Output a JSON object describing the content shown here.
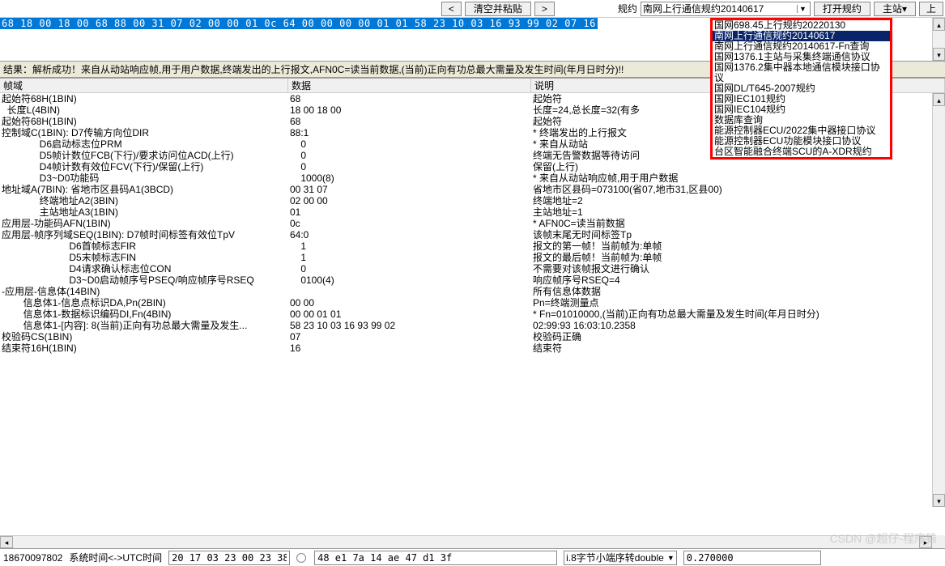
{
  "toolbar": {
    "prev_btn": "<",
    "clear_paste_btn": "清空并粘贴",
    "next_btn": ">",
    "protocol_label": "规约",
    "protocol_selected": "南网上行通信规约20140617",
    "open_protocol_btn": "打开规约",
    "master_btn": "主站",
    "more_btn": "上"
  },
  "hex_input": "68 18 00 18 00 68 88 00 31 07 02 00 00 01 0c 64 00 00 00 00 01 01 58 23 10 03 16 93 99 02 07 16",
  "result_bar": "结果：解析成功！来自从动站响应帧,用于用户数据,终端发出的上行报文,AFN0C=读当前数据,(当前)正向有功总最大需量及发生时间(年月日时分)!!",
  "headers": {
    "c1": "帧域",
    "c2": "数据",
    "c3": "说明"
  },
  "rows": [
    {
      "c1": "起始符68H(1BIN)",
      "c2": "68",
      "c3": "起始符"
    },
    {
      "c1": "  长度L(4BIN)",
      "c2": "18 00 18 00",
      "c3": "长度=24,总长度=32(有多"
    },
    {
      "c1": "起始符68H(1BIN)",
      "c2": "68",
      "c3": "起始符"
    },
    {
      "c1": "控制域C(1BIN): D7传输方向位DIR",
      "c2": "88:1",
      "c3": "* 终端发出的上行报文"
    },
    {
      "c1": "              D6启动标志位PRM",
      "c2": "    0",
      "c3": "* 来自从动站"
    },
    {
      "c1": "              D5帧计数位FCB(下行)/要求访问位ACD(上行)",
      "c2": "    0",
      "c3": "终端无告警数据等待访问"
    },
    {
      "c1": "              D4帧计数有效位FCV(下行)/保留(上行)",
      "c2": "    0",
      "c3": "保留(上行)"
    },
    {
      "c1": "              D3~D0功能码",
      "c2": "    1000(8)",
      "c3": "* 来自从动站响应帧,用于用户数据"
    },
    {
      "c1": "地址域A(7BIN): 省地市区县码A1(3BCD)",
      "c2": "00 31 07",
      "c3": "省地市区县码=073100(省07,地市31,区县00)"
    },
    {
      "c1": "              终端地址A2(3BIN)",
      "c2": "02 00 00",
      "c3": "终端地址=2"
    },
    {
      "c1": "              主站地址A3(1BIN)",
      "c2": "01",
      "c3": "主站地址=1"
    },
    {
      "c1": "应用层-功能码AFN(1BIN)",
      "c2": "0c",
      "c3": "* AFN0C=读当前数据"
    },
    {
      "c1": "应用层-帧序列域SEQ(1BIN): D7帧时间标签有效位TpV",
      "c2": "64:0",
      "c3": "该帧末尾无时间标签Tp"
    },
    {
      "c1": "                         D6首帧标志FIR",
      "c2": "    1",
      "c3": "报文的第一帧！当前帧为:单帧"
    },
    {
      "c1": "                         D5末帧标志FIN",
      "c2": "    1",
      "c3": "报文的最后帧！当前帧为:单帧"
    },
    {
      "c1": "                         D4请求确认标志位CON",
      "c2": "    0",
      "c3": "不需要对该帧报文进行确认"
    },
    {
      "c1": "                         D3~D0启动帧序号PSEQ/响应帧序号RSEQ",
      "c2": "    0100(4)",
      "c3": "响应帧序号RSEQ=4"
    },
    {
      "c1": "-应用层-信息体(14BIN)",
      "c2": "",
      "c3": "所有信息体数据"
    },
    {
      "c1": "        信息体1-信息点标识DA,Pn(2BIN)",
      "c2": "00 00",
      "c3": "Pn=终端测量点"
    },
    {
      "c1": "        信息体1-数据标识编码DI,Fn(4BIN)",
      "c2": "00 00 01 01",
      "c3": "* Fn=01010000,(当前)正向有功总最大需量及发生时间(年月日时分)"
    },
    {
      "c1": "        信息体1-[内容]: 8(当前)正向有功总最大需量及发生...",
      "c2": "58 23 10 03 16 93 99 02",
      "c3": "02:99:93 16:03:10.2358"
    },
    {
      "c1": "校验码CS(1BIN)",
      "c2": "07",
      "c3": "校验码正确"
    },
    {
      "c1": "结束符16H(1BIN)",
      "c2": "16",
      "c3": "结束符"
    }
  ],
  "dropdown_items": [
    {
      "label": "国网698.45上行规约20220130",
      "sel": false
    },
    {
      "label": "南网上行通信规约20140617",
      "sel": true
    },
    {
      "label": "南网上行通信规约20140617-Fn查询",
      "sel": false
    },
    {
      "label": "国网1376.1主站与采集终端通信协议",
      "sel": false
    },
    {
      "label": "国网1376.2集中器本地通信模块接口协议",
      "sel": false
    },
    {
      "label": "国网DL/T645-2007规约",
      "sel": false
    },
    {
      "label": "国网IEC101规约",
      "sel": false
    },
    {
      "label": "国网IEC104规约",
      "sel": false
    },
    {
      "label": "数据库查询",
      "sel": false
    },
    {
      "label": "能源控制器ECU/2022集中器接口协议",
      "sel": false
    },
    {
      "label": "能源控制器ECU功能模块接口协议",
      "sel": false
    },
    {
      "label": "台区智能融合终端SCU的A-XDR规约",
      "sel": false
    }
  ],
  "statusbar": {
    "num": "18670097802",
    "time_label": "系统时间<->UTC时间",
    "time_value": "20 17 03 23 00 23 38",
    "hex_value": "48 e1 7a 14 ae 47 d1 3f",
    "endian_combo": "i.8字节小端序转double",
    "double_value": "0.270000"
  },
  "watermark": "CSDN @超仔-程序猿"
}
